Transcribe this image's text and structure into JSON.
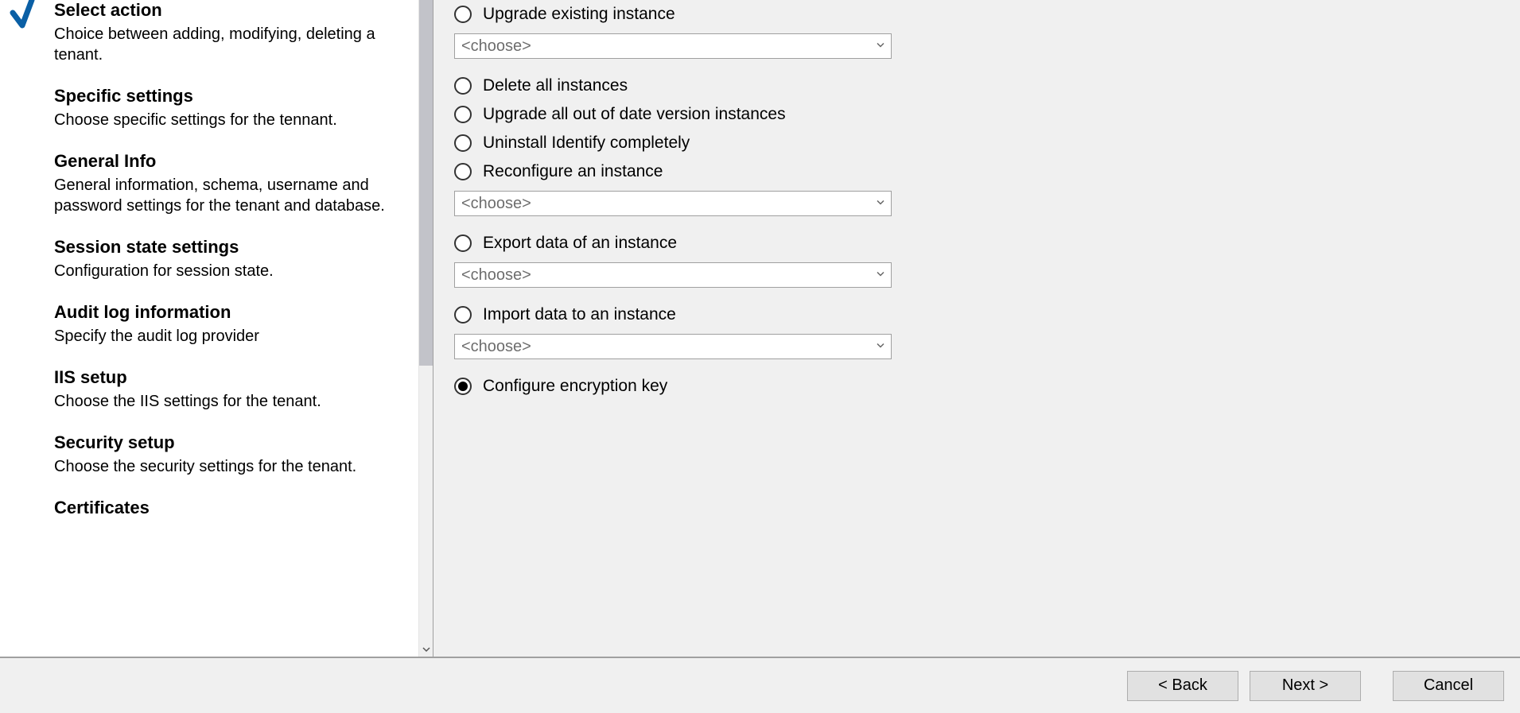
{
  "sidebar": {
    "steps": [
      {
        "title": "Select action",
        "desc": "Choice between adding, modifying, deleting a tenant.",
        "checked": true
      },
      {
        "title": "Specific settings",
        "desc": "Choose specific settings for the tennant.",
        "checked": false
      },
      {
        "title": "General Info",
        "desc": "General information, schema, username and password settings for the tenant and database.",
        "checked": false
      },
      {
        "title": "Session state settings",
        "desc": "Configuration for session state.",
        "checked": false
      },
      {
        "title": "Audit log information",
        "desc": "Specify the audit log provider",
        "checked": false
      },
      {
        "title": "IIS setup",
        "desc": "Choose the IIS settings for the tenant.",
        "checked": false
      },
      {
        "title": "Security setup",
        "desc": "Choose the security settings for the tenant.",
        "checked": false
      },
      {
        "title": "Certificates",
        "desc": "",
        "checked": false
      }
    ]
  },
  "options": {
    "upgrade_existing": "Upgrade existing instance",
    "delete_all": "Delete all instances",
    "upgrade_all_ood": "Upgrade all out of date version instances",
    "uninstall": "Uninstall Identify completely",
    "reconfigure": "Reconfigure an instance",
    "export": "Export data of an instance",
    "import": "Import data to an instance",
    "configure_key": "Configure encryption key"
  },
  "combo_placeholder": "<choose>",
  "buttons": {
    "back": "< Back",
    "next": "Next >",
    "cancel": "Cancel"
  },
  "selected_option": "configure_key"
}
